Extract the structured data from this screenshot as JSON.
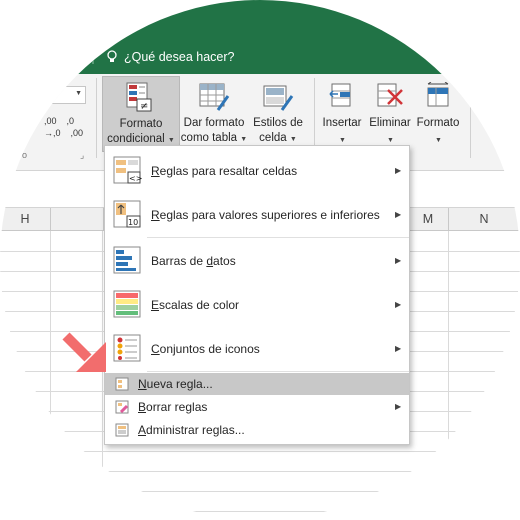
{
  "tell_me": "¿Qué desea hacer?",
  "ribbon": {
    "number_formats": [
      ",00",
      ",0",
      "→,0",
      ",00"
    ],
    "formato_condicional": [
      "Formato",
      "condicional"
    ],
    "dar_formato": [
      "Dar formato",
      "como tabla"
    ],
    "estilos": [
      "Estilos de",
      "celda"
    ],
    "insertar": "Insertar",
    "eliminar": "Eliminar",
    "formato": "Formato",
    "group_frag": "o"
  },
  "columns": {
    "h": "H",
    "m": "M",
    "n": "N"
  },
  "menu": {
    "items": [
      {
        "pre": "",
        "key": "R",
        "post": "eglas para resaltar celdas",
        "icon": "highlight-cells-icon",
        "submenu": true
      },
      {
        "pre": "",
        "key": "R",
        "post": "eglas para valores superiores e inferiores",
        "icon": "top-bottom-icon",
        "submenu": true
      },
      {
        "pre": "Barras de ",
        "key": "d",
        "post": "atos",
        "icon": "data-bars-icon",
        "submenu": true
      },
      {
        "pre": "",
        "key": "E",
        "post": "scalas de color",
        "icon": "color-scales-icon",
        "submenu": true
      },
      {
        "pre": "",
        "key": "C",
        "post": "onjuntos de iconos",
        "icon": "icon-sets-icon",
        "submenu": true
      },
      {
        "pre": "",
        "key": "N",
        "post": "ueva regla...",
        "icon": "new-rule-icon",
        "submenu": false
      },
      {
        "pre": "",
        "key": "B",
        "post": "orrar reglas",
        "icon": "clear-rules-icon",
        "submenu": true
      },
      {
        "pre": "",
        "key": "A",
        "post": "dministrar reglas...",
        "icon": "manage-rules-icon",
        "submenu": false
      }
    ]
  },
  "colors": {
    "excel_green": "#217346",
    "highlight": "#c8c8c8",
    "arrow": "#f26d6d"
  }
}
